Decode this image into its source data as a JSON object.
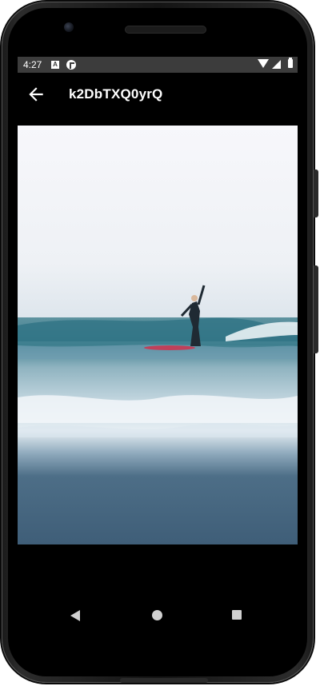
{
  "status_bar": {
    "time": "4:27",
    "left_icons": [
      "notification-a-icon",
      "notification-b-icon"
    ],
    "right_icons": [
      "wifi-icon",
      "signal-icon",
      "battery-icon"
    ]
  },
  "app_bar": {
    "title": "k2DbTXQ0yrQ",
    "back_icon": "arrow-left-icon"
  },
  "photo": {
    "subject": "surfer-on-wave"
  },
  "nav_bar": {
    "icons": [
      "triangle-back-icon",
      "circle-home-icon",
      "square-recents-icon"
    ]
  },
  "colors": {
    "screen_bg": "#000000",
    "status_bar_bg": "#3c3c3c",
    "text": "#ffffff",
    "nav_icon": "#d0d0d0"
  }
}
